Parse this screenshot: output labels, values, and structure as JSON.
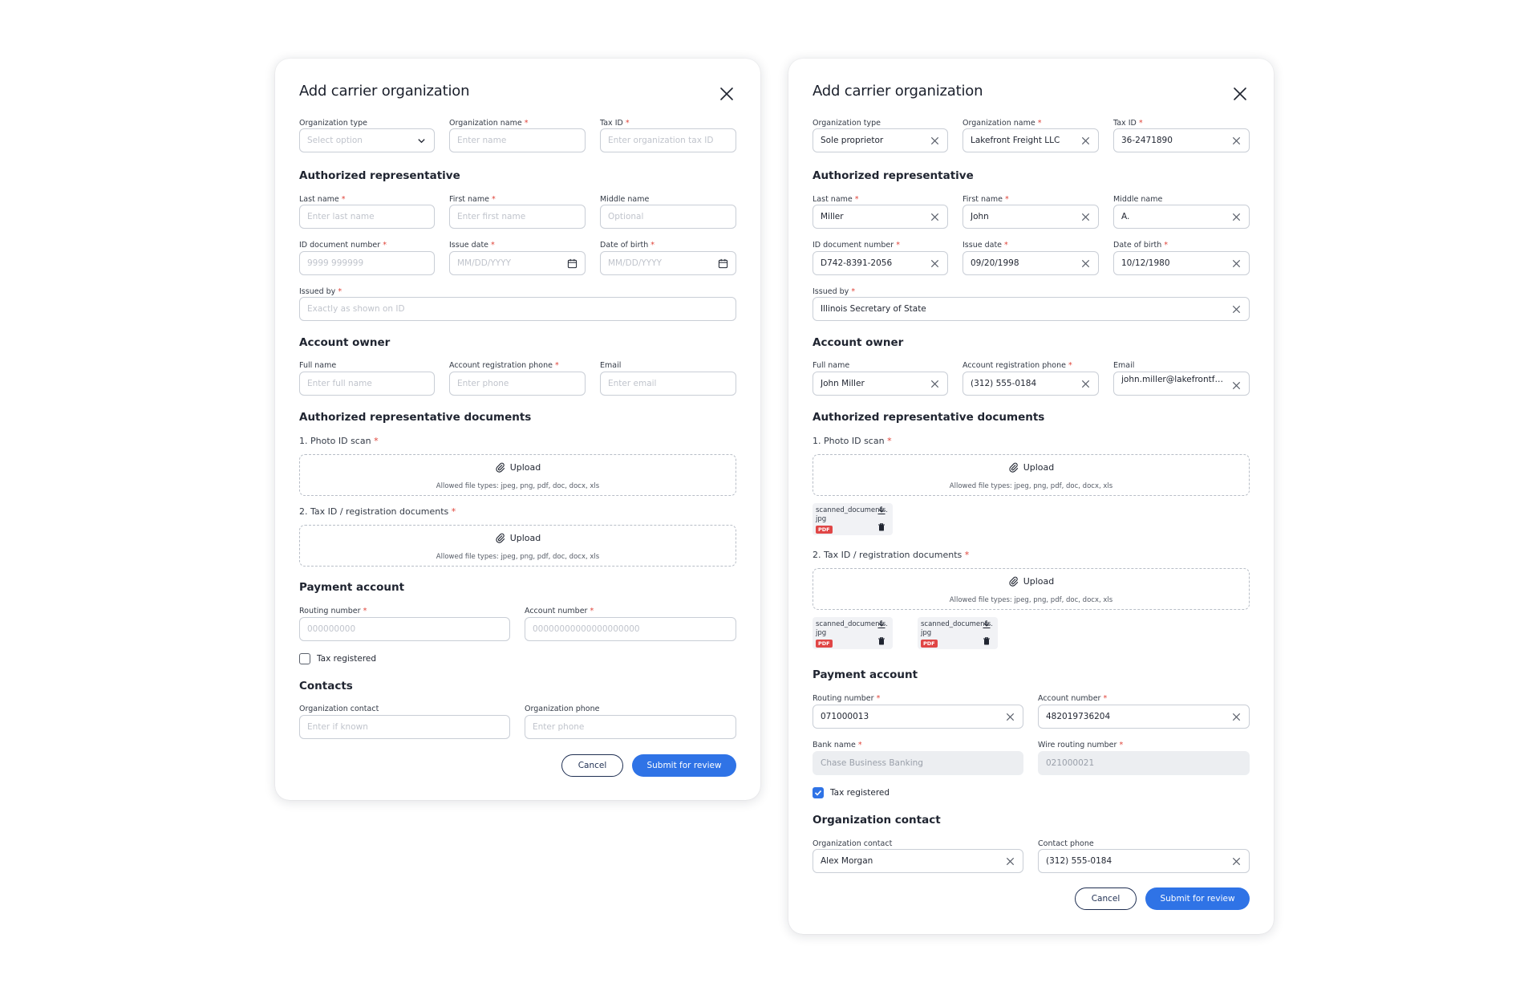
{
  "empty_form": {
    "title": "Add carrier organization",
    "org_type": {
      "label": "Organization type",
      "placeholder": "Select option"
    },
    "org_name": {
      "label": "Organization name",
      "placeholder": "Enter name"
    },
    "tax_id": {
      "label": "Tax ID",
      "placeholder": "Enter organization tax ID"
    },
    "rep_section": "Authorized representative",
    "last_name": {
      "label": "Last name",
      "placeholder": "Enter last name"
    },
    "first_name": {
      "label": "First name",
      "placeholder": "Enter first name"
    },
    "middle_name": {
      "label": "Middle name",
      "placeholder": "Optional"
    },
    "id_doc": {
      "label": "ID document number",
      "placeholder": "9999 999999"
    },
    "issue_date": {
      "label": "Issue date",
      "placeholder": "MM/DD/YYYY"
    },
    "dob": {
      "label": "Date of birth",
      "placeholder": "MM/DD/YYYY"
    },
    "issued_by": {
      "label": "Issued by",
      "placeholder": "Exactly as shown on ID"
    },
    "owner_section": "Account owner",
    "full_name": {
      "label": "Full name",
      "placeholder": "Enter full name"
    },
    "reg_phone": {
      "label": "Account registration phone",
      "placeholder": "Enter phone"
    },
    "email": {
      "label": "Email",
      "placeholder": "Enter email"
    },
    "docs_section": "Authorized representative documents",
    "doc1_label": "1. Photo ID scan",
    "doc2_label": "2. Tax ID / registration documents",
    "upload_label": "Upload",
    "upload_hint": "Allowed file types: jpeg, png, pdf, doc, docx, xls",
    "payment_section": "Payment account",
    "routing": {
      "label": "Routing number",
      "placeholder": "000000000"
    },
    "account": {
      "label": "Account number",
      "placeholder": "00000000000000000000"
    },
    "tax_registered": "Tax registered",
    "contacts_section": "Contacts",
    "org_contact": {
      "label": "Organization contact",
      "placeholder": "Enter if known"
    },
    "org_phone": {
      "label": "Organization phone",
      "placeholder": "Enter phone"
    },
    "cancel": "Cancel",
    "submit": "Submit for review"
  },
  "filled_form": {
    "title": "Add carrier organization",
    "org_type": {
      "label": "Organization type",
      "value": "Sole proprietor"
    },
    "org_name": {
      "label": "Organization name",
      "value": "Lakefront Freight LLC"
    },
    "tax_id": {
      "label": "Tax ID",
      "value": "36-2471890"
    },
    "rep_section": "Authorized representative",
    "last_name": {
      "label": "Last name",
      "value": "Miller"
    },
    "first_name": {
      "label": "First name",
      "value": "John"
    },
    "middle_name": {
      "label": "Middle name",
      "value": "A."
    },
    "id_doc": {
      "label": "ID document number",
      "value": "D742-8391-2056"
    },
    "issue_date": {
      "label": "Issue date",
      "value": "09/20/1998"
    },
    "dob": {
      "label": "Date of birth",
      "value": "10/12/1980"
    },
    "issued_by": {
      "label": "Issued by",
      "value": "Illinois Secretary of State"
    },
    "owner_section": "Account owner",
    "full_name": {
      "label": "Full name",
      "value": "John Miller"
    },
    "reg_phone": {
      "label": "Account registration phone",
      "value": "(312) 555-0184"
    },
    "email": {
      "label": "Email",
      "value": "john.miller@lakefrontfrei..."
    },
    "docs_section": "Authorized representative documents",
    "doc1_label": "1. Photo ID scan",
    "doc2_label": "2. Tax ID / registration documents",
    "upload_label": "Upload",
    "upload_hint": "Allowed file types: jpeg, png, pdf, doc, docx, xls",
    "file1": {
      "name": "scanned_documents.\njpg",
      "badge": "PDF"
    },
    "file2": {
      "name": "scanned_documents.\njpg",
      "badge": "PDF"
    },
    "file3": {
      "name": "scanned_documents.\njpg",
      "badge": "PDF"
    },
    "payment_section": "Payment account",
    "routing": {
      "label": "Routing number",
      "value": "071000013"
    },
    "account": {
      "label": "Account number",
      "value": "482019736204"
    },
    "bank_name": {
      "label": "Bank name",
      "value": "Chase Business Banking"
    },
    "wire_routing": {
      "label": "Wire routing number",
      "value": "021000021"
    },
    "tax_registered": "Tax registered",
    "contact_section": "Organization contact",
    "org_contact": {
      "label": "Organization contact",
      "value": "Alex Morgan"
    },
    "contact_phone": {
      "label": "Contact phone",
      "value": "(312) 555-0184"
    },
    "cancel": "Cancel",
    "submit": "Submit for review"
  },
  "colors": {
    "accent": "#2f73e6",
    "required": "#e0443a",
    "pdf_badge": "#e04646",
    "border": "#c9ced6"
  }
}
